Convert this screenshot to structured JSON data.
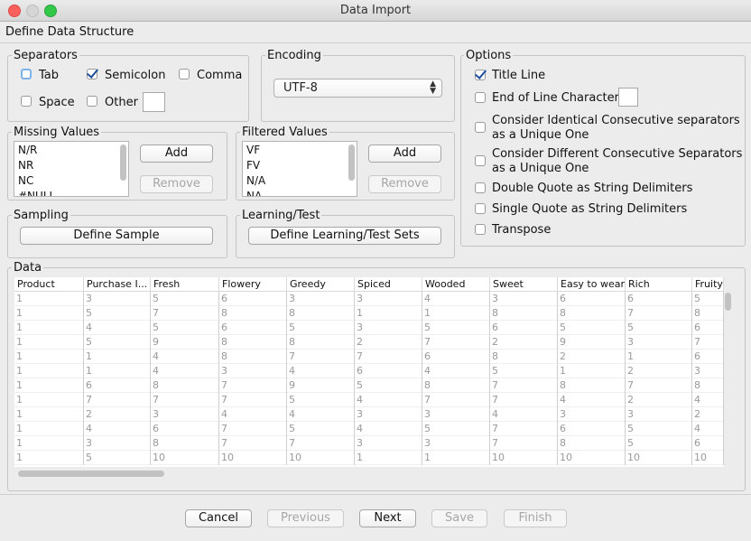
{
  "window": {
    "title": "Data Import"
  },
  "section_title": "Define Data Structure",
  "separators": {
    "label": "Separators",
    "tab": {
      "label": "Tab",
      "checked": false
    },
    "semicolon": {
      "label": "Semicolon",
      "checked": true
    },
    "comma": {
      "label": "Comma",
      "checked": false
    },
    "space": {
      "label": "Space",
      "checked": false
    },
    "other": {
      "label": "Other",
      "checked": false,
      "value": ""
    }
  },
  "encoding": {
    "label": "Encoding",
    "value": "UTF-8"
  },
  "options": {
    "label": "Options",
    "title_line": {
      "label": "Title Line",
      "checked": true
    },
    "eol": {
      "label": "End of Line Character",
      "checked": false,
      "value": ""
    },
    "identical": {
      "line1": "Consider Identical Consecutive separators",
      "line2": "as a Unique One",
      "checked": false
    },
    "different": {
      "line1": "Consider Different Consecutive Separators",
      "line2": "as a Unique One",
      "checked": false
    },
    "double_quote": {
      "label": "Double Quote as String Delimiters",
      "checked": false
    },
    "single_quote": {
      "label": "Single Quote as String Delimiters",
      "checked": false
    },
    "transpose": {
      "label": "Transpose",
      "checked": false
    }
  },
  "missing_values": {
    "label": "Missing Values",
    "items": [
      "N/R",
      "NR",
      "NC",
      "#NULL"
    ],
    "add": "Add",
    "remove": "Remove"
  },
  "filtered_values": {
    "label": "Filtered Values",
    "items": [
      "VF",
      "FV",
      "N/A",
      "NA"
    ],
    "add": "Add",
    "remove": "Remove"
  },
  "sampling": {
    "label": "Sampling",
    "button": "Define Sample"
  },
  "learning": {
    "label": "Learning/Test",
    "button": "Define Learning/Test Sets"
  },
  "data": {
    "label": "Data",
    "columns": [
      "Product",
      "Purchase I...",
      "Fresh",
      "Flowery",
      "Greedy",
      "Spiced",
      "Wooded",
      "Sweet",
      "Easy to wear",
      "Rich",
      "Fruity"
    ],
    "rows": [
      [
        "1",
        "3",
        "5",
        "6",
        "3",
        "3",
        "4",
        "3",
        "6",
        "6",
        "5"
      ],
      [
        "1",
        "5",
        "7",
        "8",
        "8",
        "1",
        "1",
        "8",
        "8",
        "7",
        "8"
      ],
      [
        "1",
        "4",
        "5",
        "6",
        "5",
        "3",
        "5",
        "6",
        "5",
        "5",
        "6"
      ],
      [
        "1",
        "5",
        "9",
        "8",
        "8",
        "2",
        "7",
        "2",
        "9",
        "3",
        "7"
      ],
      [
        "1",
        "1",
        "4",
        "8",
        "7",
        "7",
        "6",
        "8",
        "2",
        "1",
        "6"
      ],
      [
        "1",
        "1",
        "4",
        "3",
        "4",
        "6",
        "4",
        "5",
        "1",
        "2",
        "3"
      ],
      [
        "1",
        "6",
        "8",
        "7",
        "9",
        "5",
        "8",
        "7",
        "8",
        "7",
        "8"
      ],
      [
        "1",
        "7",
        "7",
        "7",
        "5",
        "4",
        "7",
        "7",
        "4",
        "2",
        "4"
      ],
      [
        "1",
        "2",
        "3",
        "4",
        "4",
        "3",
        "3",
        "4",
        "3",
        "3",
        "2"
      ],
      [
        "1",
        "4",
        "6",
        "7",
        "5",
        "4",
        "5",
        "7",
        "6",
        "5",
        "4"
      ],
      [
        "1",
        "3",
        "8",
        "7",
        "7",
        "3",
        "3",
        "7",
        "8",
        "5",
        "6"
      ],
      [
        "1",
        "5",
        "10",
        "10",
        "10",
        "1",
        "1",
        "10",
        "10",
        "10",
        "10"
      ]
    ]
  },
  "footer": {
    "cancel": "Cancel",
    "previous": "Previous",
    "next": "Next",
    "save": "Save",
    "finish": "Finish"
  }
}
